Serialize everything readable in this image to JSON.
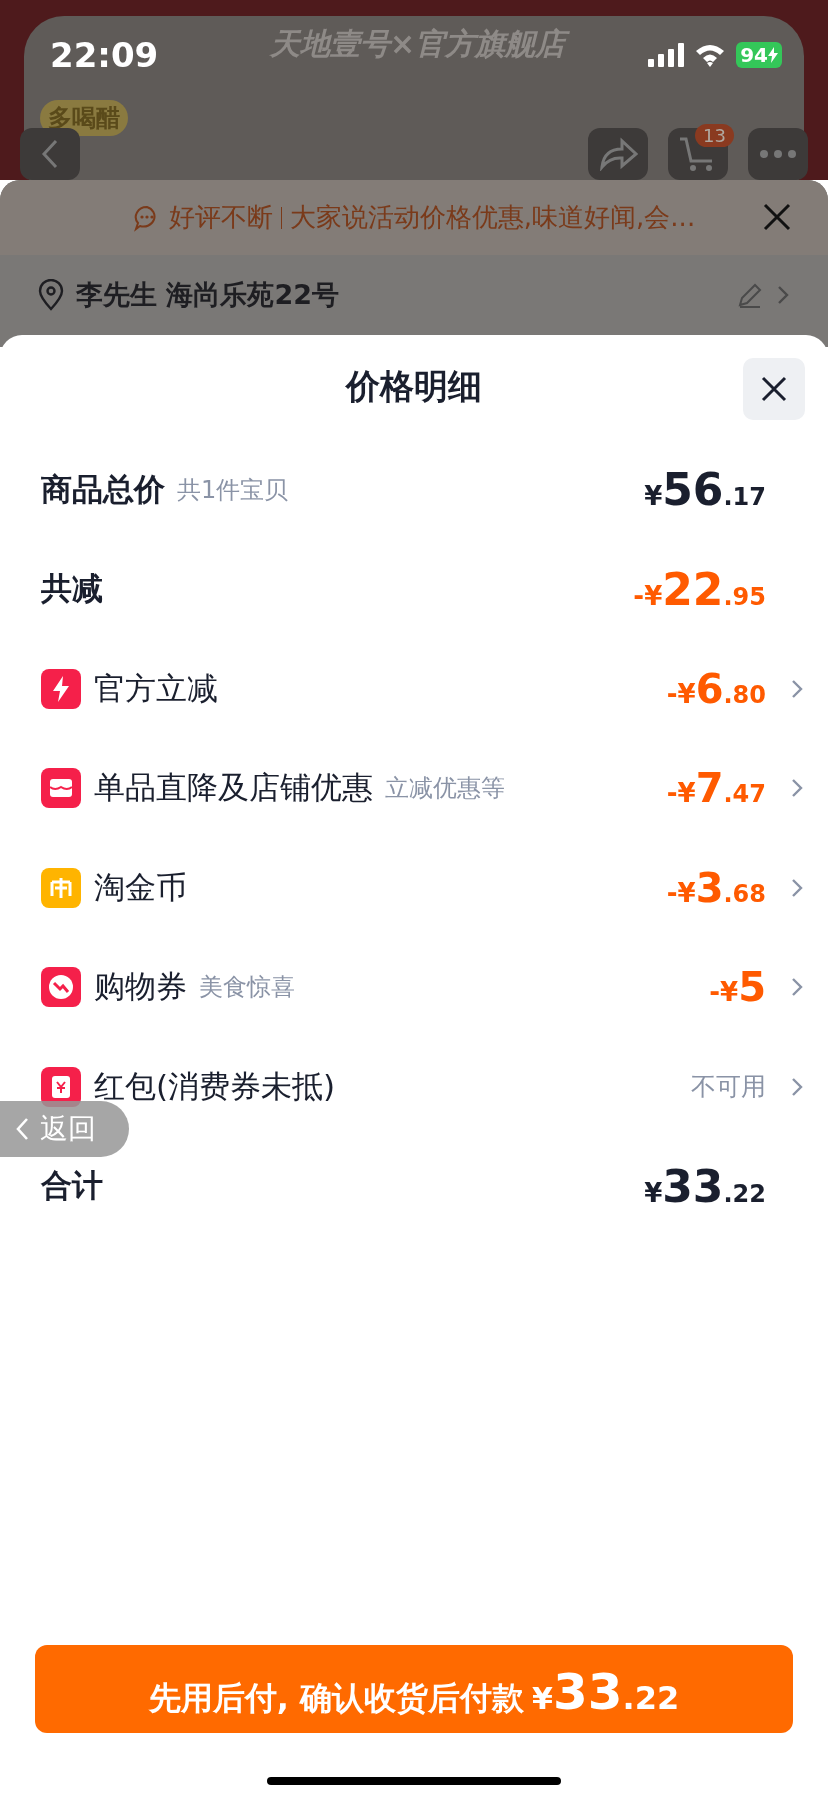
{
  "status_bar": {
    "time": "22:09",
    "battery": "94"
  },
  "store_header": {
    "banner": "天地壹号×官方旗舰店",
    "sticker": "多喝醋",
    "cart_count": "13"
  },
  "notice": {
    "tag": "好评不断",
    "text": "大家说活动价格优惠,味道好闻,会..."
  },
  "address": {
    "text": "李先生 海尚乐苑22号"
  },
  "sheet": {
    "title": "价格明细",
    "rows": [
      {
        "kind": "price",
        "label": "商品总价",
        "note": "共1件宝贝",
        "prefix": "¥",
        "integer": "56",
        "decimal": ".17",
        "chevron": false
      },
      {
        "kind": "reduction",
        "label": "共减",
        "prefix": "-¥",
        "integer": "22",
        "decimal": ".95",
        "chevron": false
      },
      {
        "kind": "discount",
        "label": "官方立减",
        "prefix": "-¥",
        "integer": "6",
        "decimal": ".80",
        "chevron": true
      },
      {
        "kind": "discount",
        "label": "单品直降及店铺优惠",
        "note": "立减优惠等",
        "prefix": "-¥",
        "integer": "7",
        "decimal": ".47",
        "chevron": true
      },
      {
        "kind": "discount",
        "label": "淘金币",
        "prefix": "-¥",
        "integer": "3",
        "decimal": ".68",
        "chevron": true
      },
      {
        "kind": "discount",
        "label": "购物券",
        "note": "美食惊喜",
        "prefix": "-¥",
        "integer": "5",
        "chevron": true
      },
      {
        "kind": "unavailable",
        "label": "红包(消费券未抵)",
        "status": "不可用",
        "chevron": true
      },
      {
        "kind": "price",
        "label": "合计",
        "prefix": "¥",
        "integer": "33",
        "decimal": ".22",
        "chevron": false
      }
    ],
    "pay_button": {
      "text": "先用后付, 确认收货后付款",
      "prefix": "¥",
      "integer": "33",
      "decimal": ".22"
    }
  },
  "back_pill": {
    "label": "返回"
  }
}
